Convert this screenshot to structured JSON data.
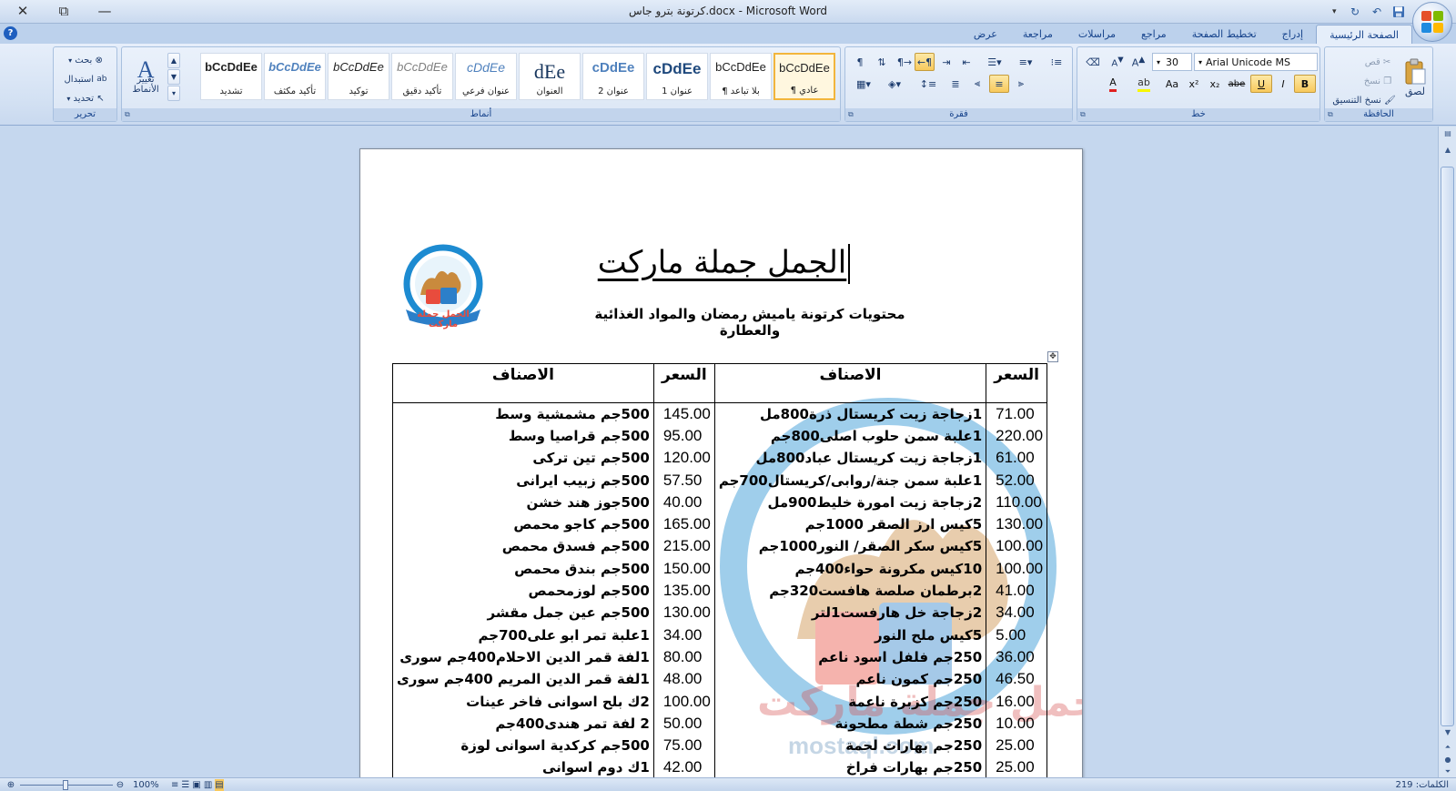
{
  "window": {
    "title": "كرتونة بترو جاس.docx - Microsoft Word",
    "close_glyph": "✕",
    "maximize_glyph": "⧉",
    "minimize_glyph": "—"
  },
  "quick_access": {
    "save_icon": "save-icon",
    "undo_icon": "undo-icon",
    "redo_icon": "redo-icon"
  },
  "tabs": [
    "الصفحة الرئيسية",
    "إدراج",
    "تخطيط الصفحة",
    "مراجع",
    "مراسلات",
    "مراجعة",
    "عرض"
  ],
  "ribbon": {
    "clipboard": {
      "label": "الحافظة",
      "paste": "لصق",
      "cut": "قص",
      "copy": "نسخ",
      "format_painter": "نسخ التنسيق"
    },
    "font": {
      "label": "خط",
      "font_name": "Arial Unicode MS",
      "font_size": "30",
      "bold": "B",
      "italic": "I",
      "underline": "U"
    },
    "paragraph": {
      "label": "فقرة"
    },
    "styles": {
      "label": "أنماط",
      "change_styles": "تغيير الأنماط",
      "items": [
        {
          "sample": "bCcDdEe",
          "name": "¶ عادي"
        },
        {
          "sample": "bCcDdEe",
          "name": "¶ بلا تباعد"
        },
        {
          "sample": "cDdEe",
          "name": "عنوان 1"
        },
        {
          "sample": "cDdEe",
          "name": "عنوان 2"
        },
        {
          "sample": "dEe",
          "name": "العنوان"
        },
        {
          "sample": "cDdEe",
          "name": "عنوان فرعي"
        },
        {
          "sample": "bCcDdEe",
          "name": "تأكيد دقيق"
        },
        {
          "sample": "bCcDdEe",
          "name": "توكيد"
        },
        {
          "sample": "bCcDdEe",
          "name": "تأكيد مكثف"
        },
        {
          "sample": "bCcDdEe",
          "name": "تشديد"
        }
      ]
    },
    "editing": {
      "label": "تحرير",
      "find": "بحث",
      "replace": "استبدال",
      "select": "تحديد"
    }
  },
  "document": {
    "title": "الجمل جملة ماركت",
    "subtitle": "محتويات كرتونة ياميش رمضان والمواد الغذائية والعطارة",
    "logo_text": "الجمل جملة ماركت",
    "watermark_text": "الجمل جملة ماركت",
    "watermark_url": "mostaql.com",
    "table": {
      "headers": [
        "السعر",
        "الاصناف",
        "السعر",
        "الاصناف"
      ],
      "rows": [
        {
          "price1": "71.00",
          "item1": "1زجاجة زيت كريستال ذرة800مل",
          "price2": "145.00",
          "item2": "500جم مشمشية وسط"
        },
        {
          "price1": "220.00",
          "item1": "1علبة سمن حلوب اصلى800جم",
          "price2": "95.00",
          "item2": "500جم قراصيا وسط"
        },
        {
          "price1": "61.00",
          "item1": "1زجاجة زيت كريستال عباد800مل",
          "price2": "120.00",
          "item2": "500جم تين تركى"
        },
        {
          "price1": "52.00",
          "item1": "1علبة سمن جنة/روابى/كريستال700جم",
          "price2": "57.50",
          "item2": "500جم زبيب ايرانى"
        },
        {
          "price1": "110.00",
          "item1": "2زجاجة زيت امورة خليط900مل",
          "price2": "40.00",
          "item2": "500جوز هند خشن"
        },
        {
          "price1": "130.00",
          "item1": "5كيس ارز الصقر 1000جم",
          "price2": "165.00",
          "item2": "500جم كاجو محمص"
        },
        {
          "price1": "100.00",
          "item1": "5كيس سكر الصقر/ النور1000جم",
          "price2": "215.00",
          "item2": "500جم فسدق محمص"
        },
        {
          "price1": "100.00",
          "item1": "10كيس مكرونة حواء400جم",
          "price2": "150.00",
          "item2": "500جم بندق محمص"
        },
        {
          "price1": "41.00",
          "item1": "2برطمان صلصة هافست320جم",
          "price2": "135.00",
          "item2": "500جم لوزمحمص"
        },
        {
          "price1": "34.00",
          "item1": "2زجاجة خل هارفست1لتر",
          "price2": "130.00",
          "item2": "500جم عين جمل مقشر"
        },
        {
          "price1": "5.00",
          "item1": "5كيس ملح النور",
          "price2": "34.00",
          "item2": "1علبة تمر ابو على700جم"
        },
        {
          "price1": "36.00",
          "item1": "250جم فلفل اسود ناعم",
          "price2": "80.00",
          "item2": "1لفة قمر الدين الاحلام400جم سورى"
        },
        {
          "price1": "46.50",
          "item1": "250جم كمون ناعم",
          "price2": "48.00",
          "item2": "1لفة قمر الدين المريم 400جم سورى"
        },
        {
          "price1": "16.00",
          "item1": "250جم كزبرة ناعمة",
          "price2": "100.00",
          "item2": "2ك بلح اسوانى فاخر عينات"
        },
        {
          "price1": "10.00",
          "item1": "250جم شطة مطحونة",
          "price2": "50.00",
          "item2": "2 لفة تمر هندى400جم"
        },
        {
          "price1": "25.00",
          "item1": "250جم بهارات لحمة",
          "price2": "75.00",
          "item2": "500جم كركدية اسوانى لوزة"
        },
        {
          "price1": "25.00",
          "item1": "250جم بهارات فراخ",
          "price2": "42.00",
          "item2": "1ك دوم اسوانى"
        }
      ]
    }
  },
  "statusbar": {
    "word_count": "الكلمات: 219",
    "zoom": "100%"
  },
  "colors": {
    "ribbon_bg": "#dbe6f5",
    "workspace_bg": "#c5d7ee",
    "accent": "#15428b",
    "selected_style": "#f2b53c"
  }
}
